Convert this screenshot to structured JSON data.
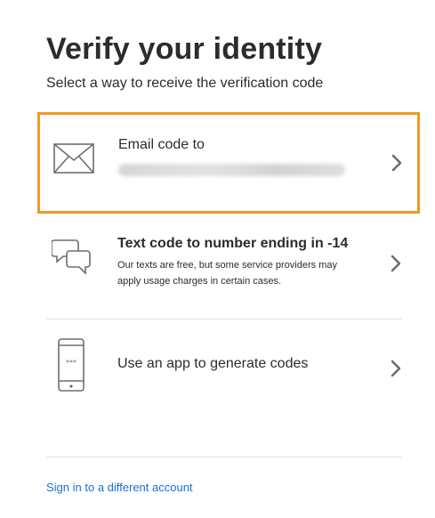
{
  "header": {
    "title": "Verify your identity",
    "subtitle": "Select a way to receive the verification code"
  },
  "options": [
    {
      "label": "Email code to",
      "detail_redacted": true,
      "icon": "envelope-icon",
      "selected": true
    },
    {
      "label": "Text code to number ending in -14",
      "description": "Our texts are free, but some service providers may apply usage charges in certain cases.",
      "icon": "chat-bubbles-icon"
    },
    {
      "label": "Use an app to generate codes",
      "icon": "phone-icon"
    }
  ],
  "footer": {
    "link": "Sign in to a different account"
  },
  "colors": {
    "selected_border": "#ef9a24",
    "link": "#1a6fd6",
    "text": "#2c2c2c",
    "icon": "#6e6e6e",
    "divider": "#e6e6e6"
  }
}
